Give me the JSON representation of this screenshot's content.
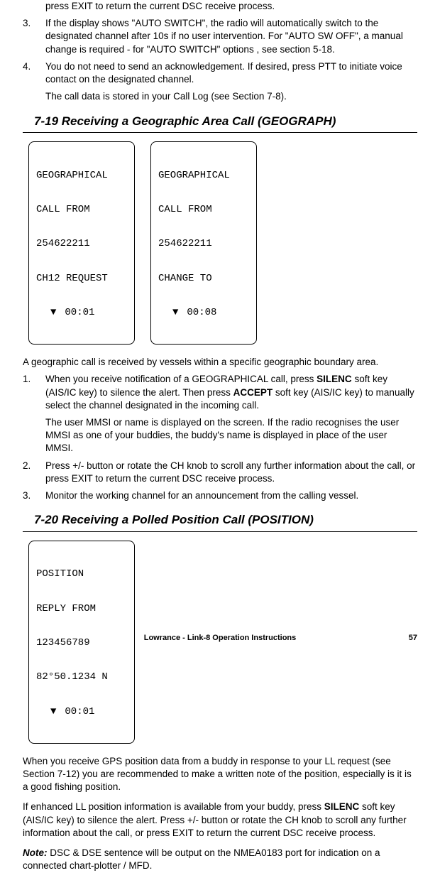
{
  "intro": {
    "line1": "press EXIT to return the current DSC receive process.",
    "item3": "If the display shows \"AUTO SWITCH\", the radio will automatically switch to the designated channel after 10s if no user intervention. For \"AUTO SW OFF\", a manual change is required - for \"AUTO SWITCH\" options , see section 5-18.",
    "item4": "You do not need to send an acknowledgement. If desired, press PTT to initiate voice contact on the designated channel.",
    "item4b": "The call data is stored in your Call Log (see Section 7-8)."
  },
  "section719": {
    "title": "7-19 Receiving a Geographic Area Call (GEOGRAPH)",
    "lcd1": {
      "l1": "GEOGRAPHICAL",
      "l2": "CALL FROM",
      "l3": "254622211",
      "l4": "CH12 REQUEST",
      "arrow": "▼",
      "time": "00:01"
    },
    "lcd2": {
      "l1": "GEOGRAPHICAL",
      "l2": "CALL FROM",
      "l3": "254622211",
      "l4": "CHANGE TO",
      "arrow": "▼",
      "time": "00:08"
    },
    "lead": "A geographic call is received by vessels within a specific geographic boundary area.",
    "item1a": "When you receive notification of a GEOGRAPHICAL call, press ",
    "item1_bold1": "SILENC",
    "item1b": " soft key (AIS/IC key) to silence the alert. Then press ",
    "item1_bold2": "ACCEPT",
    "item1c": " soft key (AIS/IC key) to manually select the channel designated in the incoming call.",
    "item1sub": "The user MMSI or name is displayed on the screen. If the radio recognises the user MMSI as one of your buddies, the buddy's name is displayed in place of the user MMSI.",
    "item2": "Press +/- button or rotate the CH knob to scroll any further information about the call, or press EXIT to return the current DSC receive process.",
    "item3": "Monitor the working channel for an announcement from the calling vessel."
  },
  "section720": {
    "title": "7-20 Receiving a Polled Position Call (POSITION)",
    "lcd": {
      "l1": "POSITION",
      "l2": "REPLY FROM",
      "l3": "123456789",
      "l4": "82°50.1234 N",
      "arrow": "▼",
      "time": "00:01"
    },
    "p1": "When you receive GPS position data from a buddy in response to your LL request (see Section 7-12) you are recommended to make a written note of the position, especially is it is a good fishing position.",
    "p2a": "If enhanced LL position information is available from your buddy, press ",
    "p2_bold": "SILENC",
    "p2b": " soft key (AIS/IC key) to silence the alert. Press +/- button or rotate the CH knob to scroll any further information about the call, or press EXIT to return the current DSC receive process.",
    "note_label": "Note:",
    "note_body": " DSC & DSE sentence will be output on the NMEA0183 port for indication on a connected chart-plotter / MFD."
  },
  "footer": {
    "center": "Lowrance - Link-8 Operation Instructions",
    "page": "57"
  },
  "labels": {
    "n3": "3.",
    "n4": "4.",
    "n1": "1.",
    "n2": "2."
  }
}
